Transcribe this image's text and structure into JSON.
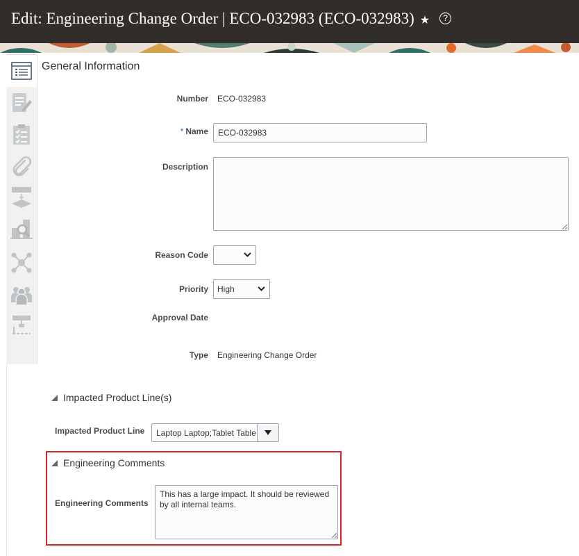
{
  "header": {
    "title": "Edit: Engineering Change Order | ECO-032983 (ECO-032983)",
    "favorite_icon": "star-icon",
    "help_icon": "help-icon",
    "help_glyph": "?"
  },
  "sidebar": {
    "items": [
      {
        "icon": "list-icon",
        "active": true
      },
      {
        "icon": "edit-document-icon"
      },
      {
        "icon": "checklist-icon"
      },
      {
        "icon": "paperclip-icon"
      },
      {
        "icon": "workflow-icon"
      },
      {
        "icon": "search-document-icon"
      },
      {
        "icon": "network-icon"
      },
      {
        "icon": "people-icon"
      },
      {
        "icon": "hierarchy-icon"
      }
    ]
  },
  "general": {
    "title": "General Information",
    "number_label": "Number",
    "number_value": "ECO-032983",
    "name_required": "*",
    "name_label": "Name",
    "name_value": "ECO-032983",
    "description_label": "Description",
    "description_value": "",
    "reason_code_label": "Reason Code",
    "reason_code_value": "",
    "priority_label": "Priority",
    "priority_value": "High",
    "approval_date_label": "Approval Date",
    "approval_date_value": "",
    "type_label": "Type",
    "type_value": "Engineering Change Order"
  },
  "impacted": {
    "title": "Impacted Product Line(s)",
    "label": "Impacted Product Line",
    "value": "Laptop Laptop;Tablet Table"
  },
  "comments": {
    "title": "Engineering Comments",
    "label": "Engineering Comments",
    "value": "This has a large impact. It should be reviewed by all internal teams."
  },
  "colors": {
    "header_bg": "#312d2a",
    "highlight_border": "#d9262c",
    "required_marker": "#0572ce"
  }
}
